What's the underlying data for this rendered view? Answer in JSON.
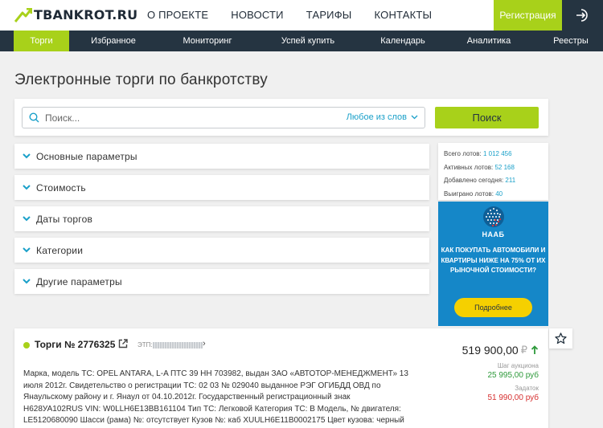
{
  "header": {
    "logo_text": "TBANKROT.RU",
    "nav": [
      "О ПРОЕКТЕ",
      "НОВОСТИ",
      "ТАРИФЫ",
      "КОНТАКТЫ"
    ],
    "register_label": "Регистрация",
    "login_icon": "login-icon"
  },
  "subnav": {
    "items": [
      "Торги",
      "Избранное",
      "Мониторинг",
      "Успей купить",
      "Календарь",
      "Аналитика",
      "Реестры"
    ],
    "active": "Торги"
  },
  "page_title": "Электронные торги по банкротству",
  "search": {
    "placeholder": "Поиск...",
    "mode": "Любое из слов",
    "button": "Поиск"
  },
  "filters": [
    "Основные параметры",
    "Стоимость",
    "Даты торгов",
    "Категории",
    "Другие параметры"
  ],
  "stats": [
    {
      "label": "Всего лотов:",
      "value": "1 012 456"
    },
    {
      "label": "Активных лотов:",
      "value": "52 168"
    },
    {
      "label": "Добавлено сегодня:",
      "value": "211"
    },
    {
      "label": "Выиграно лотов:",
      "value": "40"
    }
  ],
  "banner": {
    "brand": "НААБ",
    "text": "КАК ПОКУПАТЬ АВТОМОБИЛИ И КВАРТИРЫ НИЖЕ НА 75% ОТ ИХ РЫНОЧНОЙ СТОИМОСТИ?",
    "button": "Подробнее",
    "colors": {
      "background": "#1587c8",
      "button": "#f5d000"
    }
  },
  "listing": {
    "title": "Торги № 2776325",
    "etp_label": "ЭТП:",
    "description": "Марка, модель ТС: OPEL ANTARA, L-A ПТС 39 НН 703982, выдан ЗАО «АВТОТОР-МЕНЕДЖМЕНТ» 13 июля 2012г. Свидетельство о регистрации ТС: 02 03 № 029040 выданное РЭГ ОГИБДД ОВД по Янаульскому району и г. Янаул от 04.10.2012г. Государственный регистрационный знак Н628УА102RUS VIN: W0LLH6E13BB161104 Тип ТС: Легковой Категория ТС: В Модель, № двигателя: LE5120680090 Шасси (рама) №: отсутствует Кузов №: каб XUULH6E11B0002175 Цвет кузова: черный",
    "price": "519 900,00",
    "currency": "₽",
    "step_label": "Шаг аукциона",
    "step_value": "25 995,00 руб",
    "deposit_label": "Задаток",
    "deposit_value": "51 990,00 руб"
  },
  "colors": {
    "accent": "#a8d11a",
    "dark": "#253441",
    "link": "#1aa0c9",
    "positive": "#2e9a3b",
    "negative": "#d63030"
  }
}
